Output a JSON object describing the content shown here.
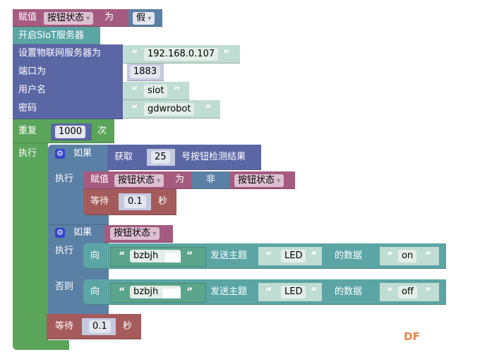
{
  "set_var": {
    "label": "赋值",
    "var": "按钮状态",
    "as": "为",
    "value": "假"
  },
  "siot_start": {
    "label": "开启SIoT服务器"
  },
  "mqtt_setup": {
    "server_label": "设置物联网服务器为",
    "server": "192.168.0.107",
    "port_label": "端口为",
    "port": "1883",
    "user_label": "用户名",
    "user": "siot",
    "pass_label": "密码",
    "pass": "gdwrobot"
  },
  "repeat": {
    "label": "重复",
    "count": "1000",
    "times": "次",
    "do": "执行"
  },
  "if1": {
    "label": "如果",
    "get": "获取",
    "pin": "25",
    "cond": "号按钮检测结果",
    "do": "执行",
    "set": {
      "label": "赋值",
      "var": "按钮状态",
      "as": "为",
      "not": "非",
      "var2": "按钮状态"
    },
    "wait": {
      "label": "等待",
      "value": "0.1",
      "unit": "秒"
    }
  },
  "if2": {
    "label": "如果",
    "var": "按钮状态",
    "do": "执行",
    "else": "否则",
    "pub_on": {
      "to": "向",
      "target": "bzbjh",
      "topic_label": "发送主题",
      "topic": "LED",
      "data_label": "的数据",
      "data": "on"
    },
    "pub_off": {
      "to": "向",
      "target": "bzbjh",
      "topic_label": "发送主题",
      "topic": "LED",
      "data_label": "的数据",
      "data": "off"
    }
  },
  "wait": {
    "label": "等待",
    "value": "0.1",
    "unit": "秒"
  },
  "watermark": "DF",
  "colors": {
    "variables": "#a55b80",
    "siot": "#5ba5a5",
    "mqtt": "#5b67a5",
    "loop": "#5ba55b",
    "logic": "#5b80a5",
    "wait": "#a55b5b",
    "watermark": "#e8834a"
  }
}
